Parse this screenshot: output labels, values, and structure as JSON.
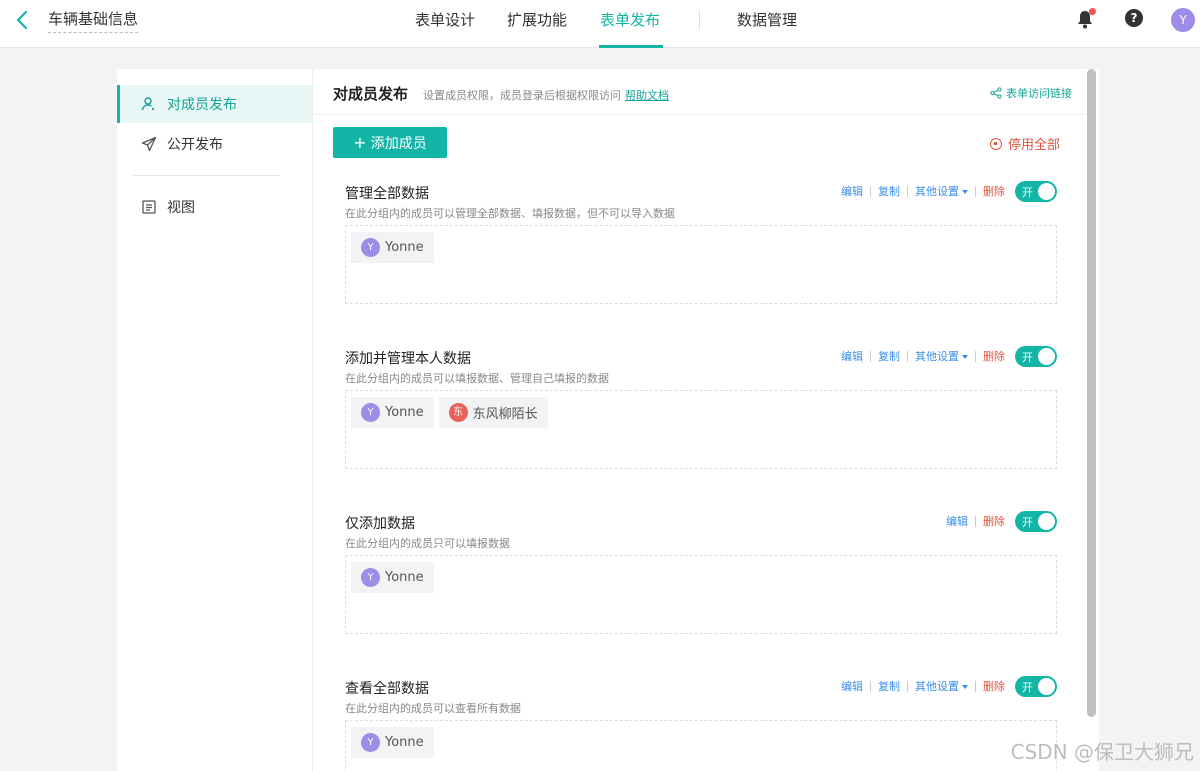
{
  "header": {
    "form_title": "车辆基础信息",
    "nav": [
      {
        "label": "表单设计",
        "active": false
      },
      {
        "label": "扩展功能",
        "active": false
      },
      {
        "label": "表单发布",
        "active": true
      },
      {
        "label": "数据管理",
        "active": false
      }
    ],
    "user_initial": "Y",
    "help_glyph": "?",
    "notification_dot": true
  },
  "sidebar": {
    "items": [
      {
        "label": "对成员发布",
        "icon": "member-icon",
        "active": true
      },
      {
        "label": "公开发布",
        "icon": "send-icon",
        "active": false
      },
      {
        "label": "视图",
        "icon": "view-icon",
        "active": false
      }
    ]
  },
  "content": {
    "title": "对成员发布",
    "description": "设置成员权限，成员登录后根据权限访问",
    "help_link": "帮助文档",
    "access_link": "表单访问链接",
    "add_member_label": "添加成员",
    "add_glyph": "+",
    "disable_all_label": "停用全部",
    "groups": [
      {
        "name": "管理全部数据",
        "desc": "在此分组内的成员可以管理全部数据、填报数据，但不可以导入数据",
        "actions": {
          "edit": "编辑",
          "copy": "复制",
          "more": "其他设置",
          "delete": "删除"
        },
        "toggle": "开",
        "members": [
          {
            "initial": "Y",
            "name": "Yonne",
            "color": "#9f8be8"
          }
        ]
      },
      {
        "name": "添加并管理本人数据",
        "desc": "在此分组内的成员可以填报数据、管理自己填报的数据",
        "actions": {
          "edit": "编辑",
          "copy": "复制",
          "more": "其他设置",
          "delete": "删除"
        },
        "toggle": "开",
        "members": [
          {
            "initial": "Y",
            "name": "Yonne",
            "color": "#9f8be8"
          },
          {
            "initial": "东",
            "name": "东风柳陌长",
            "color": "#e8615b"
          }
        ]
      },
      {
        "name": "仅添加数据",
        "desc": "在此分组内的成员只可以填报数据",
        "actions": {
          "edit": "编辑",
          "delete": "删除"
        },
        "toggle": "开",
        "members": [
          {
            "initial": "Y",
            "name": "Yonne",
            "color": "#9f8be8"
          }
        ]
      },
      {
        "name": "查看全部数据",
        "desc": "在此分组内的成员可以查看所有数据",
        "actions": {
          "edit": "编辑",
          "copy": "复制",
          "more": "其他设置",
          "delete": "删除"
        },
        "toggle": "开",
        "members": [
          {
            "initial": "Y",
            "name": "Yonne",
            "color": "#9f8be8"
          }
        ]
      }
    ]
  },
  "watermark": "CSDN @保卫大狮兄",
  "colors": {
    "accent": "#13b5a7",
    "danger": "#e2543c",
    "link": "#3a8ee6"
  }
}
